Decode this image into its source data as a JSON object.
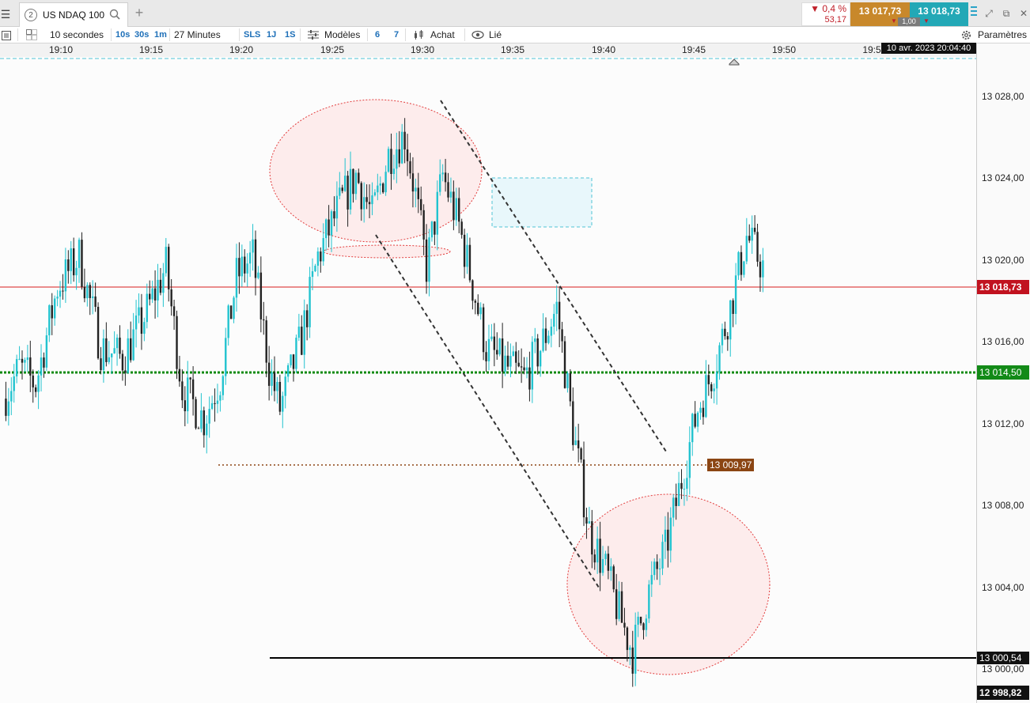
{
  "topbar": {
    "tab_number": "2",
    "tab_title": "US NDAQ 100",
    "change_percent": "0,4 %",
    "change_value": "53,17",
    "bid": "13 017,73",
    "ask": "13 018,73",
    "quantity": "1,00"
  },
  "toolbar": {
    "interval": "10 secondes",
    "btn_10s": "10s",
    "btn_30s": "30s",
    "btn_1m": "1m",
    "duration": "27 Minutes",
    "btn_sls": "SLS",
    "btn_1j": "1J",
    "btn_1s": "1S",
    "models": "Modèles",
    "btn_6": "6",
    "btn_7": "7",
    "buy": "Achat",
    "linked": "Lié",
    "settings": "Paramètres"
  },
  "time_axis": {
    "labels": [
      "19:10",
      "19:15",
      "19:20",
      "19:25",
      "19:30",
      "19:35",
      "19:40",
      "19:45",
      "19:50",
      "19:5"
    ],
    "cursor_datetime": "10 avr. 2023 20:04:40"
  },
  "price_axis": {
    "labels": [
      "13 028,00",
      "13 024,00",
      "13 020,00",
      "13 016,00",
      "13 012,00",
      "13 008,00",
      "13 004,00",
      "13 000,00"
    ],
    "current_price": "13 018,73",
    "green_level": "13 014,50",
    "support_level": "13 000,54",
    "low_price": "12 998,82",
    "brown_level": "13 009,97"
  },
  "colors": {
    "bull": "#22c3cf",
    "bear": "#222222",
    "current_line": "#d81b1b",
    "green_line": "#0f8a0f",
    "brown_line": "#8b4513",
    "ellipse_stroke": "#e23b3b",
    "ellipse_fill": "#fdecec"
  },
  "chart_data": {
    "type": "candlestick",
    "symbol": "US NDAQ 100",
    "interval": "10 secondes",
    "x_range": [
      "19:08",
      "19:48"
    ],
    "y_range": [
      12997.5,
      13030.0
    ],
    "close_path": [
      [
        0,
        13012.5
      ],
      [
        6,
        13014.0
      ],
      [
        12,
        13013.2
      ],
      [
        20,
        13018.0
      ],
      [
        28,
        13019.5
      ],
      [
        36,
        13015.0
      ],
      [
        44,
        13014.5
      ],
      [
        52,
        13016.5
      ],
      [
        60,
        13019.0
      ],
      [
        66,
        13013.0
      ],
      [
        74,
        13011.5
      ],
      [
        80,
        13013.5
      ],
      [
        86,
        13018.5
      ],
      [
        92,
        13019.5
      ],
      [
        98,
        13014.0
      ],
      [
        102,
        13012.0
      ],
      [
        110,
        13015.5
      ],
      [
        116,
        13019.5
      ],
      [
        124,
        13022.0
      ],
      [
        130,
        13023.5
      ],
      [
        136,
        13021.5
      ],
      [
        142,
        13024.5
      ],
      [
        148,
        13025.5
      ],
      [
        152,
        13022.5
      ],
      [
        156,
        13019.0
      ],
      [
        162,
        13023.5
      ],
      [
        168,
        13021.0
      ],
      [
        174,
        13017.5
      ],
      [
        178,
        13015.0
      ],
      [
        186,
        13014.0
      ],
      [
        192,
        13013.5
      ],
      [
        198,
        13015.0
      ],
      [
        204,
        13017.0
      ],
      [
        210,
        13011.0
      ],
      [
        216,
        13006.0
      ],
      [
        222,
        13004.0
      ],
      [
        228,
        13001.5
      ],
      [
        232,
        13000.0
      ],
      [
        238,
        13003.0
      ],
      [
        244,
        13005.0
      ],
      [
        250,
        13008.5
      ],
      [
        256,
        13012.0
      ],
      [
        262,
        13014.0
      ],
      [
        268,
        13017.0
      ],
      [
        274,
        13020.5
      ],
      [
        280,
        13019.0
      ]
    ],
    "current_price": 13018.73,
    "levels": [
      13018.73,
      13014.5,
      13009.97,
      13000.54
    ]
  }
}
